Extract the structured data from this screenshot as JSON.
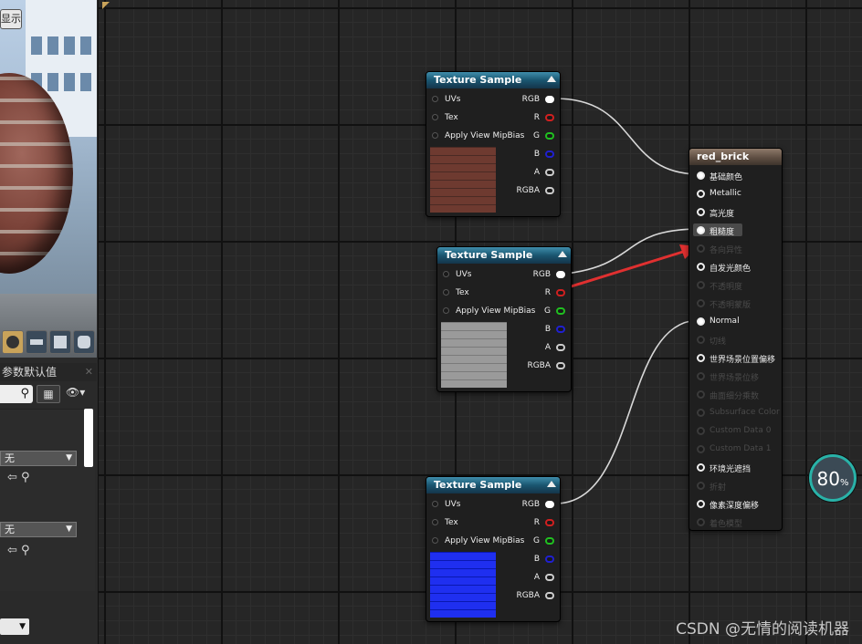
{
  "left_panel": {
    "display_button": "显示",
    "param_header": "参数默认值",
    "param_close": "✕",
    "combo_1": "无",
    "combo_2": "无"
  },
  "nodes": {
    "tex1": {
      "title": "Texture Sample",
      "inputs": [
        "UVs",
        "Tex",
        "Apply View MipBias"
      ],
      "outputs": [
        "RGB",
        "R",
        "G",
        "B",
        "A",
        "RGBA"
      ]
    },
    "tex2": {
      "title": "Texture Sample",
      "inputs": [
        "UVs",
        "Tex",
        "Apply View MipBias"
      ],
      "outputs": [
        "RGB",
        "R",
        "G",
        "B",
        "A",
        "RGBA"
      ]
    },
    "tex3": {
      "title": "Texture Sample",
      "inputs": [
        "UVs",
        "Tex",
        "Apply View MipBias"
      ],
      "outputs": [
        "RGB",
        "R",
        "G",
        "B",
        "A",
        "RGBA"
      ]
    },
    "material": {
      "title": "red_brick",
      "pins": [
        "基础颜色",
        "Metallic",
        "高光度",
        "粗糙度",
        "各向异性",
        "自发光颜色",
        "不透明度",
        "不透明蒙版",
        "Normal",
        "切线",
        "世界场景位置偏移",
        "世界场景位移",
        "曲面细分乘数",
        "Subsurface Color",
        "Custom Data 0",
        "Custom Data 1",
        "环境光遮挡",
        "折射",
        "像素深度偏移",
        "着色模型"
      ]
    }
  },
  "zoom": {
    "value": "80",
    "unit": "%"
  },
  "watermark": "CSDN @无情的阅读机器",
  "colors": {
    "accent": "#29b2a8",
    "red_arrow": "#e03030",
    "tex_header": "#1a5670",
    "material_header": "#5e4e42"
  }
}
